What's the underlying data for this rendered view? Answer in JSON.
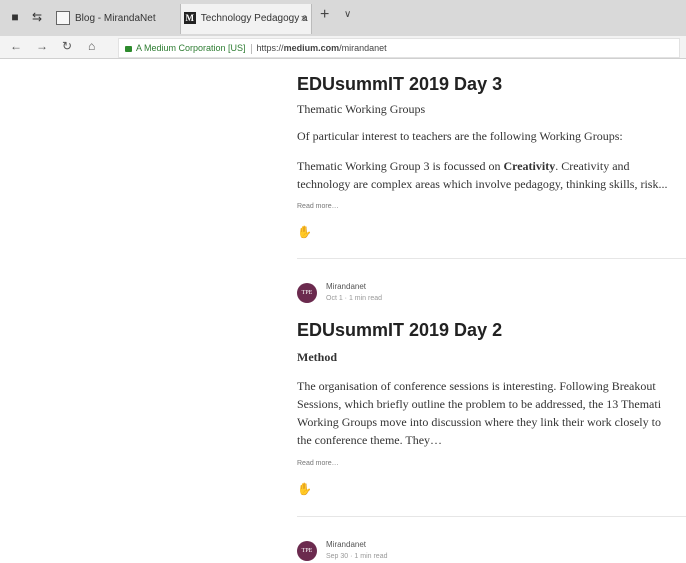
{
  "browser": {
    "tabs": [
      {
        "label": "Blog - MirandaNet",
        "active": false
      },
      {
        "label": "Technology Pedagogy a",
        "active": true
      }
    ],
    "close_glyph": "×",
    "new_tab_glyph": "+",
    "tab_menu_glyph": "∨",
    "address": {
      "secure_label": "A Medium Corporation [US]",
      "url_prefix": "https://",
      "url_domain": "medium.com",
      "url_path": "/mirandanet"
    }
  },
  "posts": [
    {
      "title": "EDUsummIT 2019 Day 3",
      "subtitle": "Thematic Working Groups",
      "paragraphs": [
        "Of particular interest to teachers are the following Working Groups:"
      ],
      "para3_pre": "Thematic Working Group 3 is focussed on ",
      "para3_bold": "Creativity",
      "para3_post": ". Creativity and",
      "para3_line2": "technology are complex areas which involve pedagogy, thinking skills, risk...",
      "read_more": "Read more…"
    },
    {
      "author": "Mirandanet",
      "avatar_text": "TPE",
      "meta": "Oct 1 · 1 min read",
      "title": "EDUsummIT 2019 Day 2",
      "subtitle": "Method",
      "lines": [
        "The organisation of conference sessions is interesting. Following Breakout",
        "Sessions, which briefly outline the problem to be addressed, the 13 Themati",
        "Working Groups move into discussion where they link their work closely to",
        "the conference theme. They…"
      ],
      "read_more": "Read more…"
    },
    {
      "author": "Mirandanet",
      "avatar_text": "TPE",
      "meta": "Sep 30 · 1 min read"
    }
  ]
}
